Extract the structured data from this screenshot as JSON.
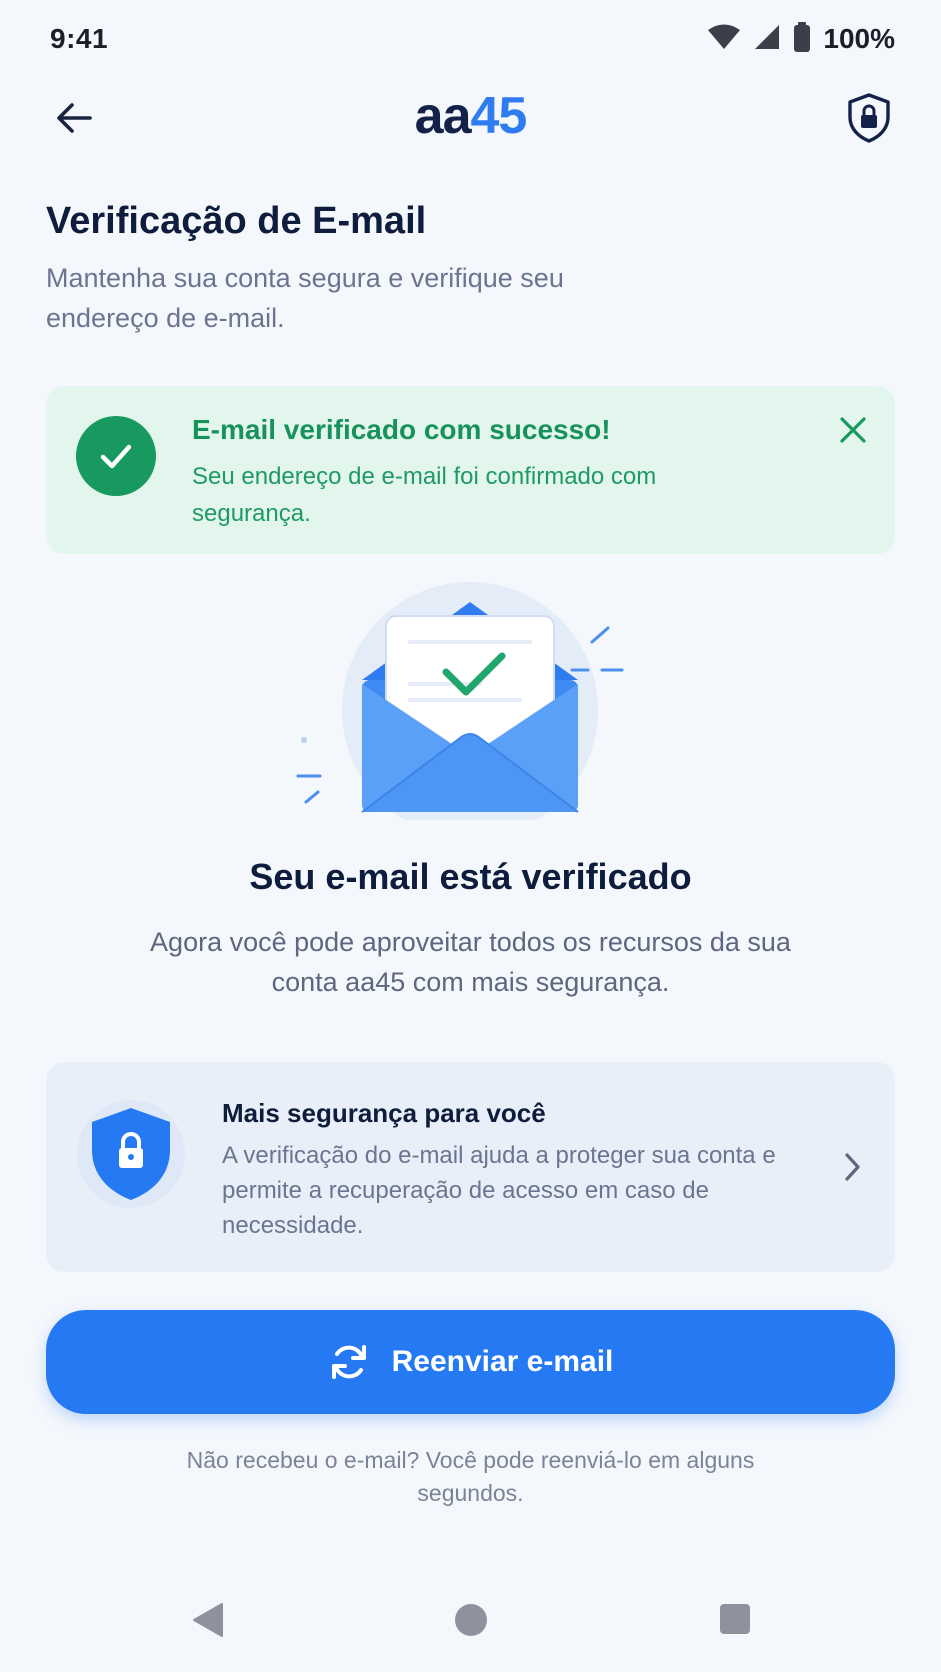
{
  "status_bar": {
    "time": "9:41",
    "battery": "100%",
    "icons": [
      "wifi-icon",
      "signal-icon",
      "battery-icon"
    ]
  },
  "header": {
    "logo_part1": "aa",
    "logo_part2": "45",
    "back_icon": "arrow-left-icon",
    "security_icon": "shield-lock-icon"
  },
  "page": {
    "title": "Verificação de E-mail",
    "subtitle": "Mantenha sua conta segura e verifique seu endereço de e-mail."
  },
  "success_alert": {
    "title": "E-mail verificado com sucesso!",
    "message": "Seu endereço de e-mail foi confirmado com segurança.",
    "icon": "check-circle-icon",
    "close_icon": "close-icon"
  },
  "illustration": {
    "icon": "envelope-check-icon"
  },
  "verified": {
    "heading": "Seu e-mail está verificado",
    "text": "Agora você pode aproveitar todos os recursos da sua conta aa45 com mais segurança."
  },
  "security_card": {
    "title": "Mais segurança para você",
    "text": "A verificação do e-mail ajuda a proteger sua conta e permite a recuperação de acesso em caso de necessidade.",
    "icon": "shield-lock-icon",
    "chevron_icon": "chevron-right-icon"
  },
  "resend": {
    "label": "Reenviar e-mail",
    "icon": "refresh-icon",
    "note": "Não recebeu o e-mail? Você pode reenviá-lo em alguns segundos."
  },
  "nav_bar": {
    "items": [
      "nav-back-icon",
      "nav-home-icon",
      "nav-recents-icon"
    ]
  },
  "colors": {
    "primary": "#2579f2",
    "success": "#17995f",
    "success_bg": "#e3f6ee",
    "text_dark": "#0f1d3d",
    "text_muted": "#6a7590",
    "background": "#f4f7fc"
  }
}
